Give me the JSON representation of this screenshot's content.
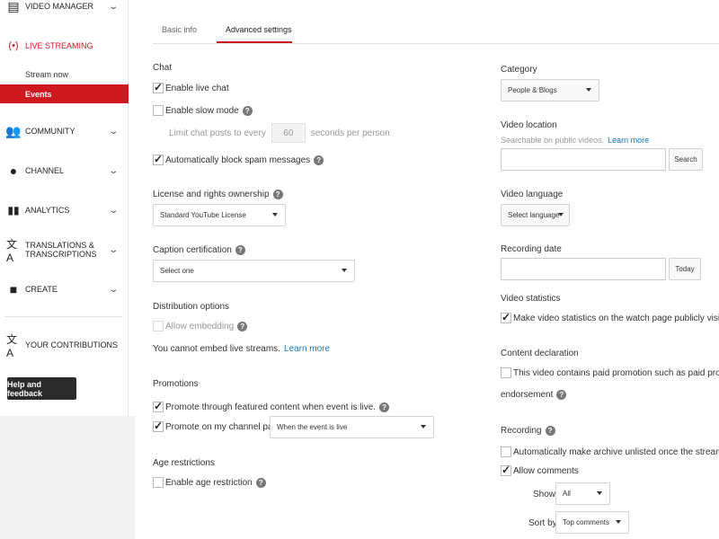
{
  "sidebar": {
    "video_manager": "VIDEO MANAGER",
    "live_streaming": "LIVE STREAMING",
    "stream_now": "Stream now",
    "events": "Events",
    "community": "COMMUNITY",
    "channel": "CHANNEL",
    "analytics": "ANALYTICS",
    "translations_line1": "TRANSLATIONS &",
    "translations_line2": "TRANSCRIPTIONS",
    "create": "CREATE",
    "your_contributions": "YOUR CONTRIBUTIONS",
    "help_feedback": "Help and feedback"
  },
  "tabs": {
    "basic_info": "Basic info",
    "advanced_settings": "Advanced settings"
  },
  "left": {
    "chat_title": "Chat",
    "enable_live_chat": "Enable live chat",
    "enable_slow_mode": "Enable slow mode",
    "limit_prefix": "Limit chat posts to every",
    "limit_value": "60",
    "limit_suffix": "seconds per person",
    "block_spam": "Automatically block spam messages",
    "license_title": "License and rights ownership",
    "license_value": "Standard YouTube License",
    "caption_title": "Caption certification",
    "caption_value": "Select one",
    "distribution_title": "Distribution options",
    "allow_embedding": "Allow embedding",
    "embed_note": "You cannot embed live streams.",
    "learn_more": "Learn more",
    "promotions_title": "Promotions",
    "promote_featured": "Promote through featured content when event is live.",
    "promote_channel": "Promote on my channel page",
    "promote_channel_value": "When the event is live",
    "age_title": "Age restrictions",
    "enable_age": "Enable age restriction"
  },
  "right": {
    "category_title": "Category",
    "category_value": "People & Blogs",
    "location_title": "Video location",
    "location_note": "Searchable on public videos.",
    "learn_more": "Learn more",
    "search_button": "Search",
    "language_title": "Video language",
    "language_value": "Select language",
    "recording_date_title": "Recording date",
    "today_button": "Today",
    "stats_title": "Video statistics",
    "stats_label": "Make video statistics on the watch page publicly visible",
    "content_title": "Content declaration",
    "content_label": "This video contains paid promotion such as paid product p",
    "content_label2": "endorsement",
    "recording_title": "Recording",
    "archive_label": "Automatically make archive unlisted once the stream has e",
    "allow_comments": "Allow comments",
    "show_label": "Show",
    "show_value": "All",
    "sort_label": "Sort by",
    "sort_value": "Top comments"
  },
  "checkbox_states": {
    "enable_live_chat": true,
    "enable_slow_mode": false,
    "block_spam": true,
    "allow_embedding": false,
    "promote_featured": true,
    "promote_channel": true,
    "enable_age": false,
    "stats": true,
    "content": false,
    "archive": false,
    "allow_comments": true
  },
  "colors": {
    "accent": "#cc181e",
    "link": "#167ac6",
    "help_button_bg": "#2b2b2b"
  }
}
